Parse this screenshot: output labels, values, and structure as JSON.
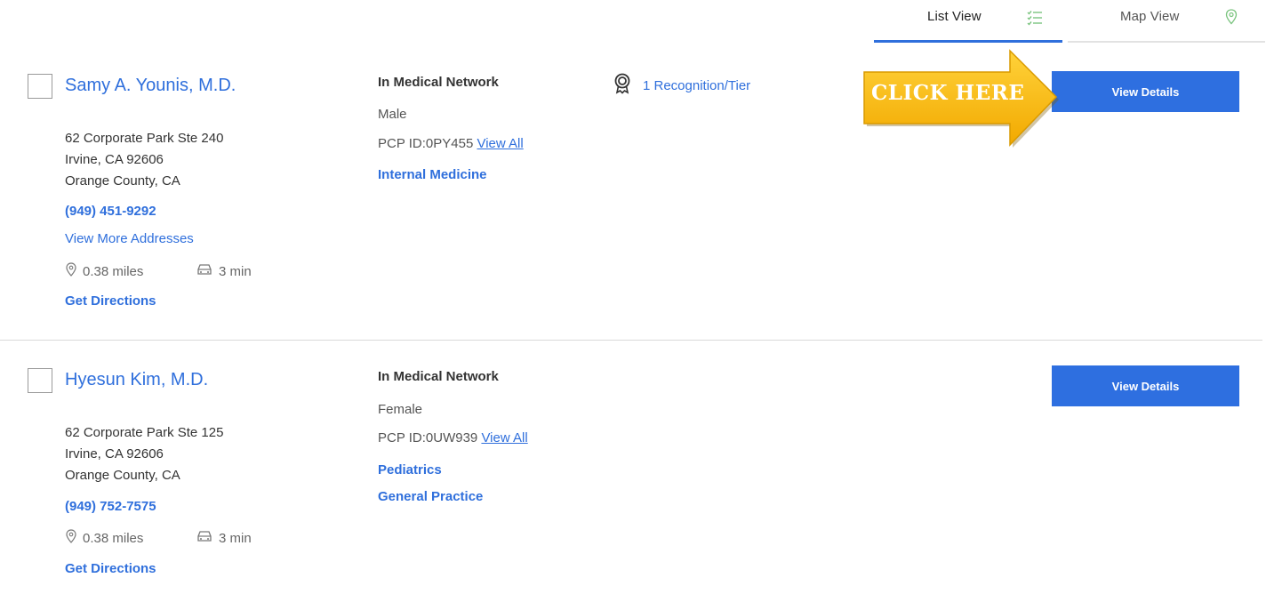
{
  "view_toggle": {
    "list_label": "List View",
    "map_label": "Map View",
    "list_icon": "list-check-icon",
    "map_icon": "map-pin-icon",
    "active": "List View"
  },
  "callout": {
    "text": "CLICK HERE",
    "icon": "arrow-right-icon",
    "color": "#f5b800"
  },
  "results": [
    {
      "name": "Samy A. Younis, M.D.",
      "address_line1": "62 Corporate Park Ste 240",
      "address_line2": "Irvine, CA 92606",
      "address_line3": "Orange County, CA",
      "phone": "(949) 451-9292",
      "more_addresses": "View More Addresses",
      "distance": "0.38 miles",
      "drive_time": "3 min",
      "directions": "Get Directions",
      "network": "In Medical Network",
      "gender": "Male",
      "pcp_id": "PCP ID:0PY455",
      "pcp_view_all": "View All",
      "specialties": [
        "Internal Medicine"
      ],
      "recognition": "1 Recognition/Tier",
      "details_button": "View Details"
    },
    {
      "name": "Hyesun Kim, M.D.",
      "address_line1": "62 Corporate Park Ste 125",
      "address_line2": "Irvine, CA 92606",
      "address_line3": "Orange County, CA",
      "phone": "(949) 752-7575",
      "distance": "0.38 miles",
      "drive_time": "3 min",
      "directions": "Get Directions",
      "network": "In Medical Network",
      "gender": "Female",
      "pcp_id": "PCP ID:0UW939",
      "pcp_view_all": "View All",
      "specialties": [
        "Pediatrics",
        "General Practice"
      ],
      "details_button": "View Details"
    }
  ],
  "colors": {
    "link": "#2f6fdc",
    "button": "#2e6fe0",
    "callout": "#f5b800"
  }
}
